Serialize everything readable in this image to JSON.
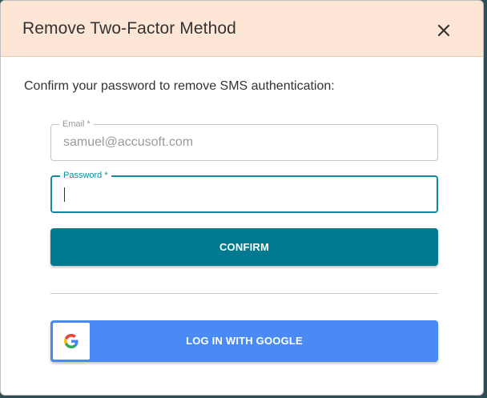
{
  "dialog": {
    "title": "Remove Two-Factor Method",
    "close_icon": "close-icon",
    "instruction": "Confirm your password to remove SMS authentication:"
  },
  "form": {
    "email": {
      "label": "Email *",
      "value": "samuel@accusoft.com"
    },
    "password": {
      "label": "Password *",
      "value": ""
    },
    "confirm_label": "CONFIRM",
    "google_label": "LOG IN WITH GOOGLE",
    "google_icon": "google-logo-icon"
  },
  "colors": {
    "header_bg": "#fde6d6",
    "primary": "#017a91",
    "focus": "#118b9b",
    "google": "#4a8af4"
  }
}
